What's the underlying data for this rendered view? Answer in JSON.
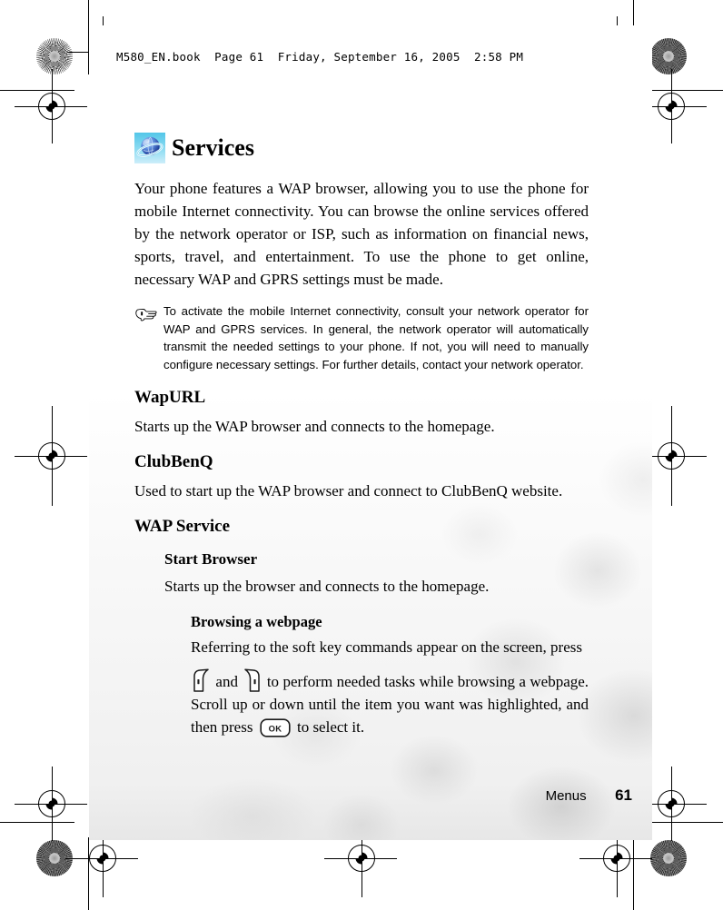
{
  "header": {
    "info_line": "M580_EN.book  Page 61  Friday, September 16, 2005  2:58 PM"
  },
  "page": {
    "title": "Services",
    "title_icon": "globe-icon",
    "intro": "Your phone features a WAP browser, allowing you to use the phone for mobile Internet connectivity. You can browse the online services offered by the network operator or ISP, such as information on financial news, sports, travel, and entertainment. To use the phone to get online, necessary WAP and GPRS settings must be made.",
    "note": {
      "icon": "pointing-hand-icon",
      "text": "To activate the mobile Internet connectivity, consult your network operator for WAP and GPRS services. In general, the network operator will automatically transmit the needed settings to your phone. If not, you will need to manually configure necessary settings. For further details, contact your network operator."
    },
    "sections": [
      {
        "heading": "WapURL",
        "body": "Starts up the WAP browser and connects to the homepage."
      },
      {
        "heading": "ClubBenQ",
        "body": "Used to start up the WAP browser and connect to ClubBenQ website."
      },
      {
        "heading": "WAP Service",
        "sub_heading": "Start Browser",
        "sub_body": "Starts up the browser and connects to the homepage.",
        "subsub_heading": "Browsing a webpage",
        "subsub_body_1": "Referring to the soft key commands appear on the screen, press",
        "subsub_body_2": "and",
        "subsub_body_3": "to perform needed tasks while browsing a webpage. Scroll up or down until the item you want was highlighted, and then press",
        "subsub_body_4": "to select it.",
        "key_left": "left-soft-key-icon",
        "key_right": "right-soft-key-icon",
        "key_ok_label": "OK"
      }
    ]
  },
  "footer": {
    "label": "Menus",
    "page_number": "61"
  },
  "colors": {
    "icon_bg_top": "#5ec9e8",
    "icon_bg_bottom": "#bfe9f6",
    "globe_blue": "#1b3f9e",
    "globe_light": "#8fb8ee",
    "text": "#000000"
  }
}
